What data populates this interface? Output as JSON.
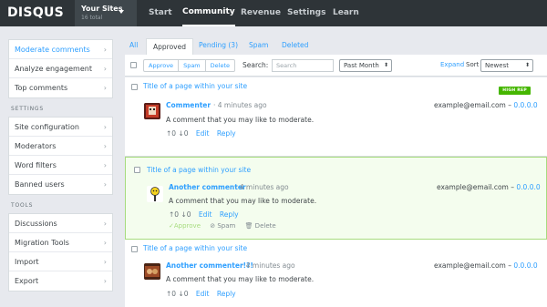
{
  "header": {
    "logo": "DISQUS",
    "sites_title": "Your Sites",
    "sites_sub": "16 total",
    "nav": [
      "Start",
      "Community",
      "Revenue",
      "Settings",
      "Learn"
    ]
  },
  "sidebar": {
    "group1": [
      {
        "label": "Moderate comments",
        "chevron": "›"
      },
      {
        "label": "Analyze engagement",
        "chevron": "›"
      },
      {
        "label": "Top comments",
        "chevron": "›"
      }
    ],
    "settings_head": "SETTINGS",
    "group2": [
      {
        "label": "Site configuration",
        "chevron": "›"
      },
      {
        "label": "Moderators",
        "chevron": "›"
      },
      {
        "label": "Word filters",
        "chevron": "›"
      },
      {
        "label": "Banned users",
        "chevron": "›"
      }
    ],
    "tools_head": "TOOLS",
    "group3": [
      {
        "label": "Discussions",
        "chevron": "›"
      },
      {
        "label": "Migration Tools",
        "chevron": "›"
      },
      {
        "label": "Import",
        "chevron": "›"
      },
      {
        "label": "Export",
        "chevron": "›"
      }
    ]
  },
  "tabs": [
    "All",
    "Approved",
    "Pending (3)",
    "Spam",
    "Deleted"
  ],
  "toolbar": {
    "approve": "Approve",
    "spam": "Spam",
    "delete": "Delete",
    "search_label": "Search:",
    "search_placeholder": "Search",
    "range": "Past Month",
    "expand": "Expand",
    "sort_label": "Sort",
    "sort": "Newest",
    "select_arrow": "⬍"
  },
  "comments": [
    {
      "title": "Title of a page within your site",
      "badge": "HIGH REP",
      "author": "Commenter",
      "time": "· 4 minutes ago",
      "message": "A comment that you may like to moderate.",
      "email": "example@email.com",
      "sep": " – ",
      "ip": "0.0.0.0",
      "up": "↑0",
      "down": "↓0",
      "edit": "Edit",
      "reply": "Reply"
    },
    {
      "title": "Title of a page within your site",
      "author": "Another commenter",
      "time": "· 4 minutes ago",
      "message": "A comment that you may like to moderate.",
      "email": "example@email.com",
      "sep": " – ",
      "ip": "0.0.0.0",
      "up": "↑0",
      "down": "↓0",
      "edit": "Edit",
      "reply": "Reply",
      "approve": "✓Approve",
      "spam": "⊘ Spam",
      "delete": "🗑 Delete"
    },
    {
      "title": "Title of a page within your site",
      "author": "Another commenter!?!",
      "time": "· 4 minutes ago",
      "message": "A comment that you may like to moderate.",
      "email": "example@email.com",
      "sep": " – ",
      "ip": "0.0.0.0",
      "up": "↑0",
      "down": "↓0",
      "edit": "Edit",
      "reply": "Reply"
    }
  ]
}
